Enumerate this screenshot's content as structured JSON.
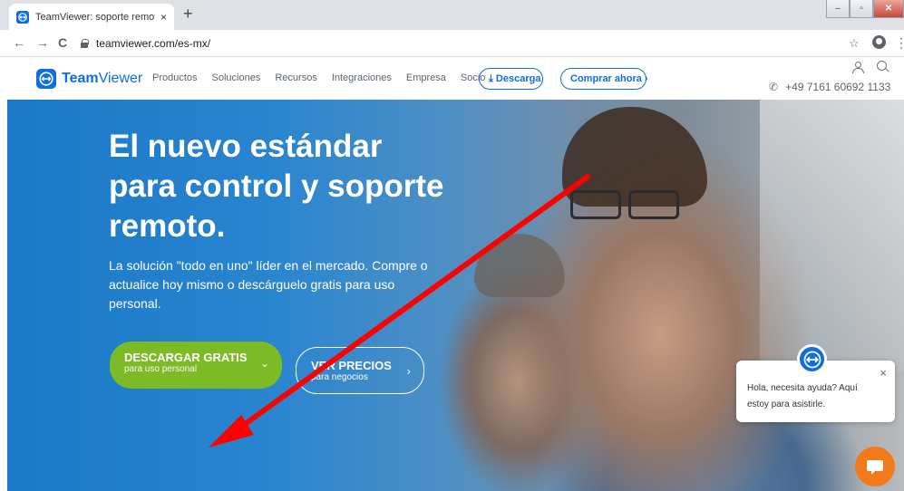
{
  "browser": {
    "tab_title": "TeamViewer: soporte remoto, ac",
    "tab_close": "×",
    "new_tab": "+",
    "url": "teamviewer.com/es-mx/",
    "back": "←",
    "forward": "→",
    "reload": "C",
    "star": "☆",
    "menu": "⋮",
    "win_minimize": "–",
    "win_maximize": "▫",
    "win_close": "✕"
  },
  "header": {
    "logo_bold": "Team",
    "logo_light": "Viewer",
    "nav": [
      "Productos",
      "Soluciones",
      "Recursos",
      "Integraciones",
      "Empresa",
      "Socio"
    ],
    "download_label": "⤓ Descarga",
    "buy_label": "Comprar ahora ›",
    "phone": "+49 7161 60692 1133",
    "phone_icon": "✆"
  },
  "hero": {
    "title": "El nuevo estándar para control y soporte remoto.",
    "subtitle": "La solución \"todo en uno\" líder en el mercado. Compre o actualice hoy mismo o descárguelo gratis para uso personal.",
    "cta_primary_title": "DESCARGAR GRATIS",
    "cta_primary_sub": "para uso personal",
    "cta_primary_chev": "⌄",
    "cta_secondary_title": "VER PRECIOS",
    "cta_secondary_sub": "para negocios",
    "cta_secondary_chev": "›"
  },
  "chat": {
    "message": "Hola, necesita ayuda? Aquí estoy para asistirle.",
    "close": "×"
  },
  "colors": {
    "brand_blue": "#0e6ddf",
    "cta_green": "#7cbb25",
    "chat_orange": "#f27a1a",
    "annotation_red": "#ff0000"
  },
  "icons": [
    "tv-logo-icon",
    "lock-icon",
    "star-icon",
    "account-icon",
    "user-icon",
    "search-icon",
    "phone-icon",
    "chat-icon",
    "annotation-arrow"
  ]
}
